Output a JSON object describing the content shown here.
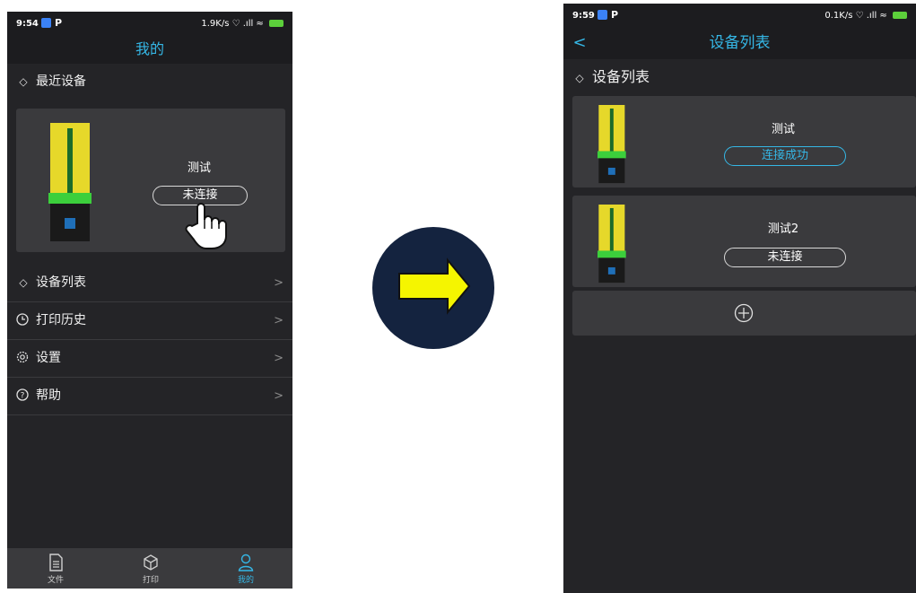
{
  "left_phone": {
    "status": {
      "time": "9:54",
      "app_letter": "P",
      "right": "1.9K/s ♡ .ıll ≈",
      "battery": "85"
    },
    "title": "我的",
    "recent": {
      "header": "最近设备",
      "device_name": "测试",
      "status_label": "未连接"
    },
    "menu": [
      {
        "label": "设备列表",
        "icon": "layers-icon"
      },
      {
        "label": "打印历史",
        "icon": "clock-icon"
      },
      {
        "label": "设置",
        "icon": "gear-icon"
      },
      {
        "label": "帮助",
        "icon": "help-icon"
      }
    ],
    "tabs": [
      {
        "label": "文件",
        "icon": "file-icon"
      },
      {
        "label": "打印",
        "icon": "cube-icon"
      },
      {
        "label": "我的",
        "icon": "user-icon"
      }
    ]
  },
  "right_phone": {
    "status": {
      "time": "9:59",
      "app_letter": "P",
      "right": "0.1K/s ♡ .ıll ≈",
      "battery": "82"
    },
    "title": "设备列表",
    "header": "设备列表",
    "devices": [
      {
        "name": "测试",
        "status": "连接成功",
        "connected": true
      },
      {
        "name": "测试2",
        "status": "未连接",
        "connected": false
      }
    ],
    "add_icon": "plus-circle-icon"
  },
  "colors": {
    "accent": "#35b7e6",
    "background": "#242427",
    "card": "#3a3a3d",
    "arrow": "#f5f500",
    "circle": "#14233f"
  }
}
